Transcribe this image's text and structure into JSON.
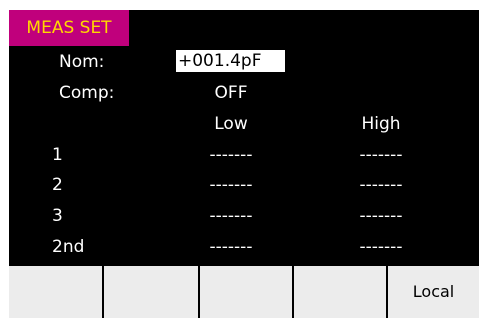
{
  "title": "MEAS SET",
  "nominal": {
    "label": "Nom:",
    "value": "+001.4pF"
  },
  "comparator": {
    "label": "Comp:",
    "value": "OFF"
  },
  "columns": {
    "low": "Low",
    "high": "High"
  },
  "rows": [
    {
      "label": "1",
      "low": "-------",
      "high": "-------"
    },
    {
      "label": "2",
      "low": "-------",
      "high": "-------"
    },
    {
      "label": "3",
      "low": "-------",
      "high": "-------"
    },
    {
      "label": "2nd",
      "low": "-------",
      "high": "-------"
    }
  ],
  "softkeys": [
    "",
    "",
    "",
    "",
    "Local"
  ],
  "colors": {
    "title_background": "#c0007c",
    "title_text": "#ffd800",
    "screen_background": "#000000",
    "softkey_background": "#ececec"
  }
}
